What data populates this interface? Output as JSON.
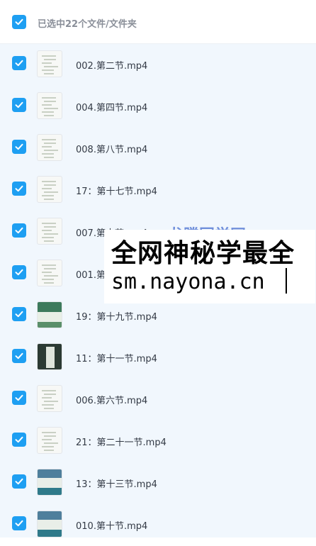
{
  "header": {
    "selected_text": "已选中22个文件/文件夹"
  },
  "files": [
    {
      "name": "002.第二节.mp4",
      "thumb": "doc"
    },
    {
      "name": "004.第四节.mp4",
      "thumb": "doc"
    },
    {
      "name": "008.第八节.mp4",
      "thumb": "doc"
    },
    {
      "name": "17：第十七节.mp4",
      "thumb": "doc"
    },
    {
      "name": "007.第十节.mp4",
      "thumb": "doc"
    },
    {
      "name": "001.第",
      "thumb": "doc"
    },
    {
      "name": "19：第十九节.mp4",
      "thumb": "slide"
    },
    {
      "name": "11：第十一节.mp4",
      "thumb": "dark"
    },
    {
      "name": "006.第六节.mp4",
      "thumb": "doc"
    },
    {
      "name": "21：第二十一节.mp4",
      "thumb": "doc"
    },
    {
      "name": "13：第十三节.mp4",
      "thumb": "photo"
    },
    {
      "name": "010.第十节.mp4",
      "thumb": "photo"
    }
  ],
  "watermark": {
    "line1": "全网神秘学最全",
    "line2": "sm.nayona.cn",
    "behind": "龙腾国学网"
  },
  "colors": {
    "checkbox": "#1e9ff2",
    "list_bg": "#f1f7fd"
  }
}
